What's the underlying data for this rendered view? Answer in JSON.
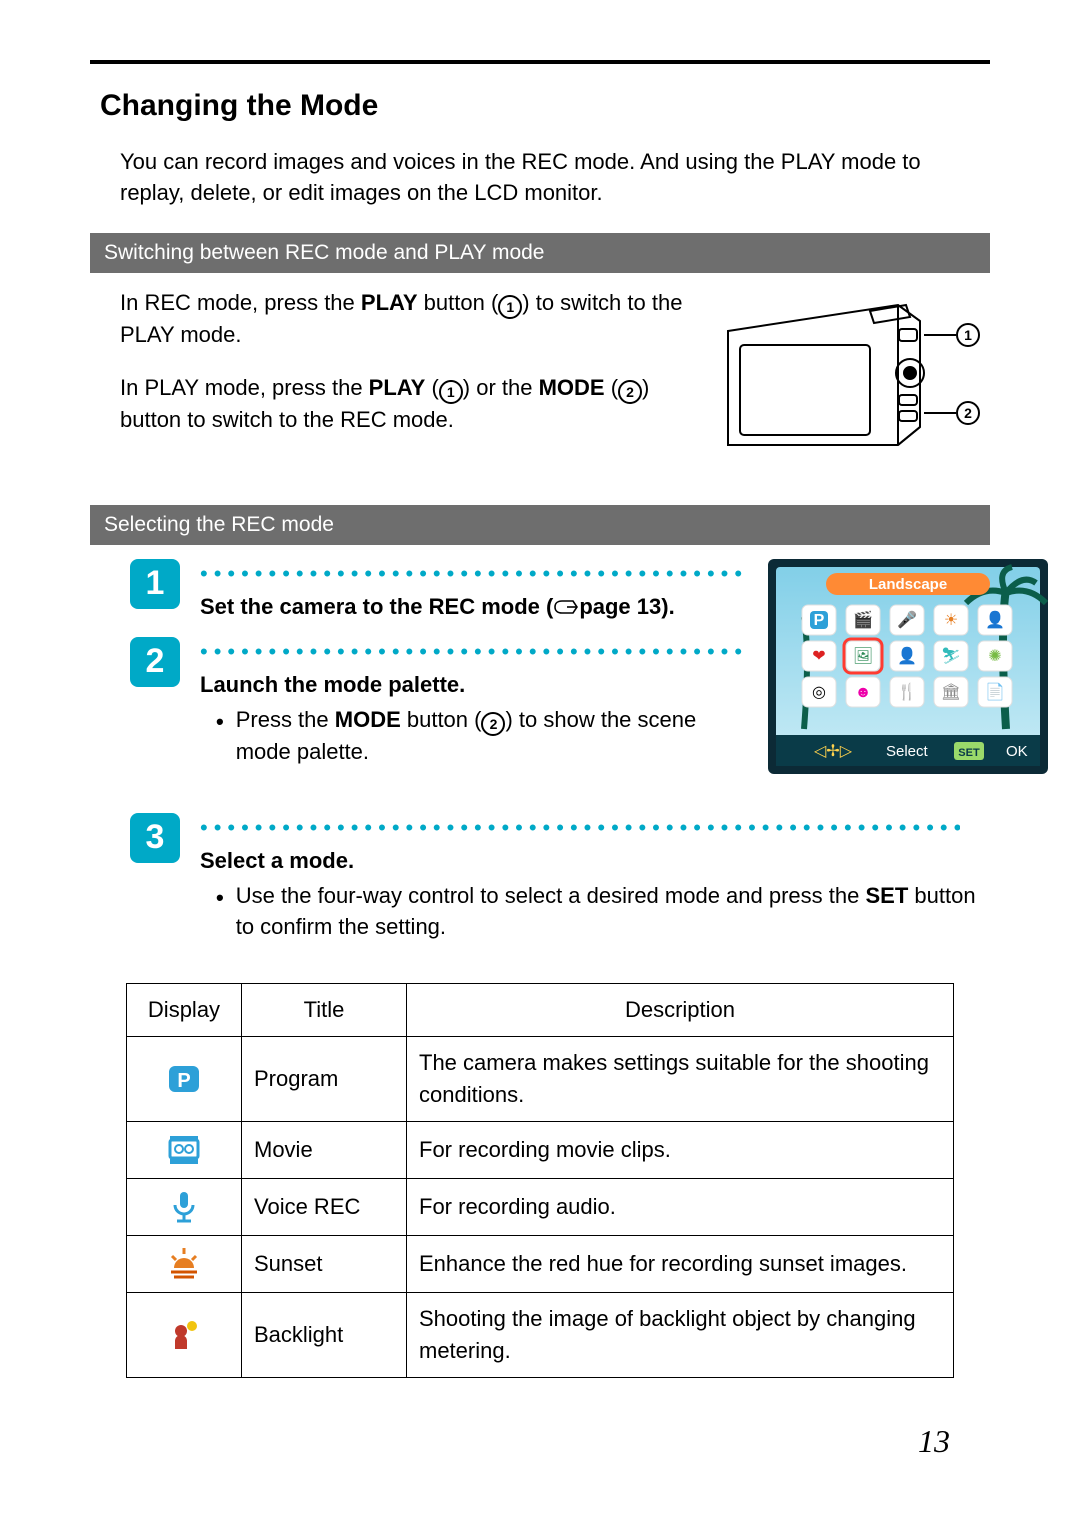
{
  "heading": "Changing the Mode",
  "intro": "You can record images and voices in the REC mode. And using the PLAY mode to replay, delete, or edit images on the LCD monitor.",
  "bar1": "Switching between REC mode and PLAY mode",
  "switch": {
    "p1_a": "In REC mode, press the ",
    "p1_b": "PLAY",
    "p1_c": " button (",
    "p1_d": ") to switch to the PLAY mode.",
    "p2_a": "In PLAY mode, press the ",
    "p2_b": "PLAY",
    "p2_c": " (",
    "p2_d": ") or the ",
    "p2_e": "MODE",
    "p2_f": " (",
    "p2_g": ") button to switch to the REC mode.",
    "callout1": "1",
    "callout2": "2"
  },
  "bar2": "Selecting the REC mode",
  "steps": {
    "n1": "1",
    "n2": "2",
    "n3": "3",
    "s1_a": "Set the camera to the REC mode (",
    "s1_b": "page 13).",
    "s2_title": "Launch the mode palette.",
    "s2_bullet_a": "Press the ",
    "s2_bullet_b": "MODE",
    "s2_bullet_c": " button (",
    "s2_bullet_d": ") to show the scene mode palette.",
    "s3_title": "Select a mode.",
    "s3_bullet_a": "Use the four-way control to select a desired mode and press the ",
    "s3_bullet_b": "SET",
    "s3_bullet_c": " button to confirm the setting."
  },
  "lcd": {
    "header": "Landscape",
    "select": "Select",
    "ok": "OK",
    "set": "SET"
  },
  "table": {
    "h_display": "Display",
    "h_title": "Title",
    "h_desc": "Description",
    "rows": [
      {
        "title": "Program",
        "desc": "The camera makes settings suitable for the shooting conditions."
      },
      {
        "title": "Movie",
        "desc": "For recording movie clips."
      },
      {
        "title": "Voice REC",
        "desc": "For recording audio."
      },
      {
        "title": "Sunset",
        "desc": "Enhance the red hue for recording sunset images."
      },
      {
        "title": "Backlight",
        "desc": "Shooting the image of backlight object by changing metering."
      }
    ]
  },
  "page_number": "13"
}
